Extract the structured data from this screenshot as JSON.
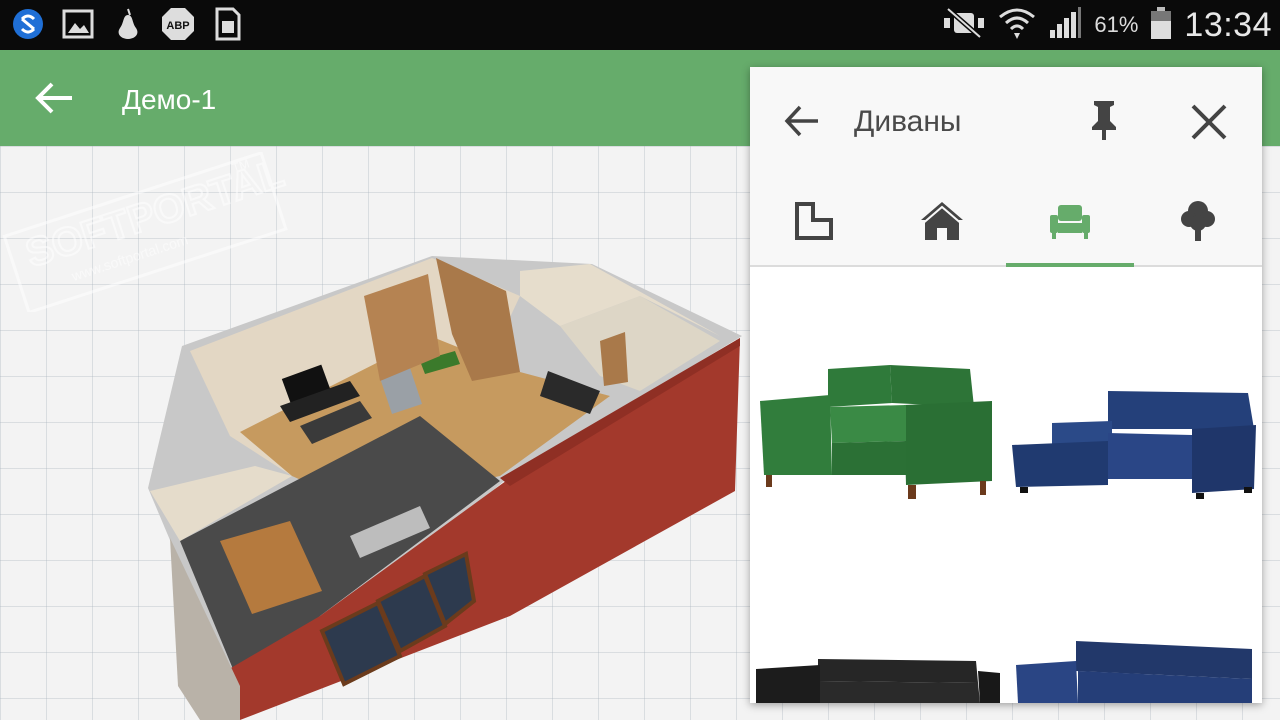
{
  "status_bar": {
    "battery_percent": "61%",
    "clock": "13:34",
    "icons": [
      "s-app-icon",
      "gallery-icon",
      "pear-icon",
      "adblock-icon",
      "sim-icon",
      "mute-icon",
      "wifi-icon",
      "signal-icon",
      "battery-icon"
    ],
    "adblock_label": "ABP"
  },
  "app_bar": {
    "title": "Демо-1",
    "back_icon": "arrow-back-icon",
    "color": "#66ac6b"
  },
  "watermark": {
    "text": "SOFTPORTAL",
    "tm": "TM",
    "url": "www.softportal.com"
  },
  "panel": {
    "title": "Диваны",
    "back_icon": "arrow-back-icon",
    "pin_icon": "pin-icon",
    "close_icon": "close-icon",
    "tabs": [
      {
        "name": "tab-rooms",
        "icon": "room-outline-icon",
        "active": false
      },
      {
        "name": "tab-house",
        "icon": "house-icon",
        "active": false
      },
      {
        "name": "tab-furniture",
        "icon": "armchair-icon",
        "active": true
      },
      {
        "name": "tab-garden",
        "icon": "tree-icon",
        "active": false
      }
    ],
    "accent": "#66ac6b",
    "items": [
      {
        "name": "green-sofa",
        "color": "#2f7a3a"
      },
      {
        "name": "blue-corner-sofa",
        "color": "#233a6e"
      },
      {
        "name": "black-leather-sofa",
        "color": "#1c1c1c"
      },
      {
        "name": "navy-sofa",
        "color": "#22386a"
      }
    ]
  }
}
